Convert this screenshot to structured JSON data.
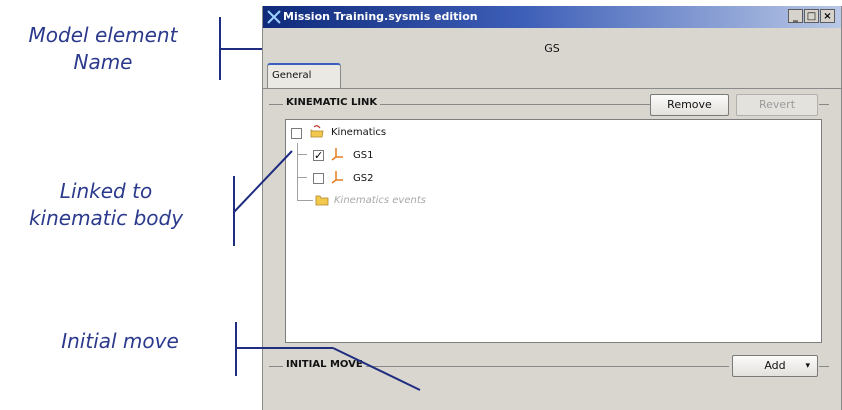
{
  "annotations": {
    "model_element_line1": "Model element",
    "model_element_line2": "Name",
    "linked_line1": "Linked to",
    "linked_line2": "kinematic body",
    "initial_move": "Initial move"
  },
  "window": {
    "title": "Mission Training.sysmis edition",
    "minimize_label": "_",
    "maximize_label": "□",
    "close_label": "×"
  },
  "element_name": "GS",
  "tabs": [
    {
      "label": "General",
      "selected": true
    }
  ],
  "kinematic_link": {
    "title": "KINEMATIC LINK",
    "remove_label": "Remove",
    "revert_label": "Revert",
    "revert_enabled": false,
    "tree": {
      "root": {
        "label": "Kinematics",
        "checked": false,
        "icon": "kinematics-folder-icon"
      },
      "children": [
        {
          "label": "GS1",
          "checked": true,
          "icon": "body-axes-icon"
        },
        {
          "label": "GS2",
          "checked": false,
          "icon": "body-axes-icon"
        },
        {
          "label": "Kinematics events",
          "icon": "folder-icon",
          "muted": true
        }
      ]
    }
  },
  "initial_move": {
    "title": "INITIAL MOVE",
    "add_label": "Add",
    "dropdown_glyph": "▾"
  },
  "colors": {
    "annotation": "#2b3a8c",
    "titlebar_start": "#0f2a7a",
    "titlebar_end": "#b9c8e6",
    "window_bg": "#d9d6cf",
    "tab_accent": "#3a5fbf"
  }
}
